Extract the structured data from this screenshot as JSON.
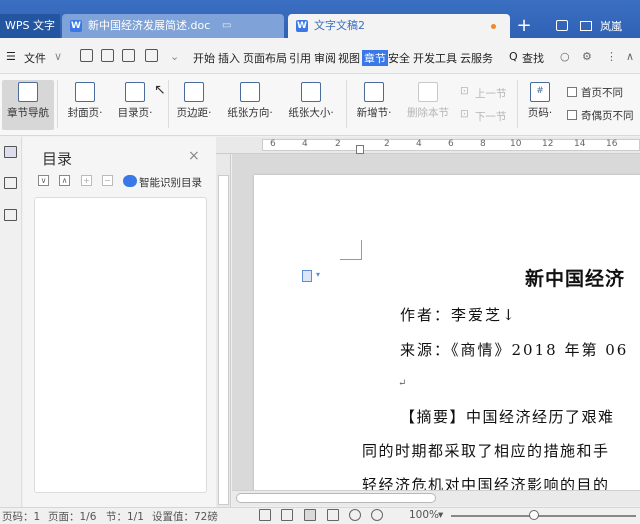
{
  "tabs": {
    "app_label": "WPS 文字",
    "doc_tab": "新中国经济发展简述.doc",
    "active_tab": "文字文稿2",
    "user": "岚嵐"
  },
  "menu": {
    "file_label": "文件",
    "items": [
      "开始",
      "插入",
      "页面布局",
      "引用",
      "审阅",
      "视图",
      "章节",
      "安全",
      "开发工具",
      "云服务"
    ],
    "active_item": "章节",
    "search_label": "查找"
  },
  "ribbon": {
    "nav_label": "章节导航",
    "cover_label": "封面页·",
    "toc_label": "目录页·",
    "margin_label": "页边距·",
    "orientation_label": "纸张方向·",
    "size_label": "纸张大小·",
    "new_section_label": "新增节·",
    "delete_section_label": "删除本节",
    "prev_section_label": "上一节",
    "next_section_label": "下一节",
    "page_number_label": "页码·",
    "first_page_label": "首页不同",
    "odd_even_label": "奇偶页不同"
  },
  "toc_panel": {
    "title": "目录",
    "smart_label": "智能识别目录"
  },
  "ruler": {
    "marks": [
      "6",
      "4",
      "2",
      "2",
      "4",
      "6",
      "8",
      "10",
      "12",
      "14",
      "16"
    ]
  },
  "document": {
    "title": "新中国经济",
    "author": "作者：李爱芝↓",
    "source": "来源：《商情》2018 年第 06",
    "mark": "↵",
    "abstract1": "【摘要】中国经济经历了艰难",
    "abstract2": "同的时期都采取了相应的措施和手",
    "abstract3": "轻经济危机对中国经济影响的目的"
  },
  "status": {
    "page_num": "页码：1",
    "pages": "页面：1/6",
    "section": "节：1/1",
    "position": "设置值：72磅",
    "zoom": "100%",
    "zoom_level": 0.45
  },
  "colors": {
    "accent": "#3b78e7",
    "tabbar": "#2f62b4"
  }
}
